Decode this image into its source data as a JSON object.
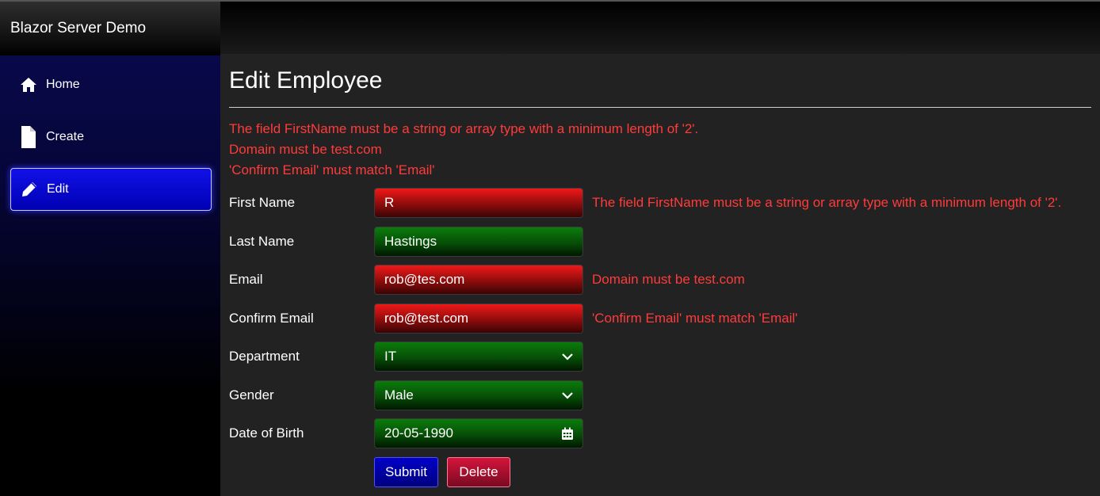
{
  "app": {
    "title": "Blazor Server Demo"
  },
  "nav": [
    {
      "label": "Home",
      "icon": "home-icon"
    },
    {
      "label": "Create",
      "icon": "file-icon"
    },
    {
      "label": "Edit",
      "icon": "pencil-icon",
      "active": true
    }
  ],
  "page": {
    "title": "Edit Employee"
  },
  "validation_summary": [
    "The field FirstName must be a string or array type with a minimum length of '2'.",
    "Domain must be test.com",
    "'Confirm Email' must match 'Email'"
  ],
  "form": {
    "first_name": {
      "label": "First Name",
      "value": "R",
      "error": "The field FirstName must be a string or array type with a minimum length of '2'."
    },
    "last_name": {
      "label": "Last Name",
      "value": "Hastings"
    },
    "email": {
      "label": "Email",
      "value": "rob@tes.com",
      "error": "Domain must be test.com"
    },
    "confirm_email": {
      "label": "Confirm Email",
      "value": "rob@test.com",
      "error": "'Confirm Email' must match 'Email'"
    },
    "department": {
      "label": "Department",
      "value": "IT"
    },
    "gender": {
      "label": "Gender",
      "value": "Male"
    },
    "dob": {
      "label": "Date of Birth",
      "value": "20-05-1990"
    }
  },
  "buttons": {
    "submit": "Submit",
    "delete": "Delete"
  },
  "colors": {
    "error": "#ff3b3b",
    "invalid": "#f01818",
    "valid": "#0b7c0b",
    "accent": "#0000c8",
    "danger": "#d4143a"
  }
}
